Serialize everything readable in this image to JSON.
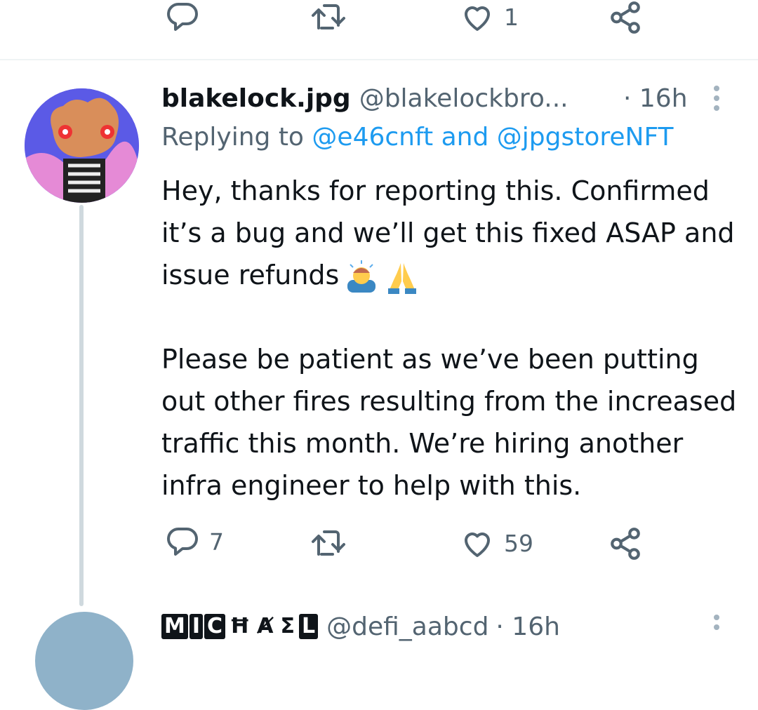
{
  "top_actions": {
    "reply_count": "",
    "retweet_count": "",
    "like_count": "1",
    "reply_icon": "reply-icon",
    "retweet_icon": "retweet-icon",
    "like_icon": "heart-icon",
    "share_icon": "share-icon"
  },
  "tweet": {
    "display_name": "blakelock.jpg",
    "handle": "@blakelockbro...",
    "time": "· 16h",
    "replying_prefix": "Replying to",
    "replying_mention_1": "@e46cnft",
    "replying_and": "and",
    "replying_mention_2": "@jpgstoreNFT",
    "paragraph_1": "Hey, thanks for reporting this. Confirmed it’s a bug and we’ll get this fixed ASAP and issue refunds",
    "paragraph_2": "Please be patient as we’ve been putting out other fires resulting from the increased traffic this month. We’re hiring another infra engineer to help with this.",
    "emojis": [
      "man-bowing-emoji",
      "folded-hands-emoji"
    ],
    "reply_count": "7",
    "retweet_count": "",
    "like_count": "59"
  },
  "next_tweet": {
    "name_letters": [
      "M",
      "I",
      "C",
      "Ħ",
      "Ⱥ",
      "Σ",
      "L"
    ],
    "handle": "@defi_aabcd",
    "time": "· 16h"
  },
  "colors": {
    "text_primary": "#0f1419",
    "text_secondary": "#536471",
    "link": "#1d9bf0",
    "divider": "#eff3f4",
    "thread_line": "#cfd9de"
  }
}
